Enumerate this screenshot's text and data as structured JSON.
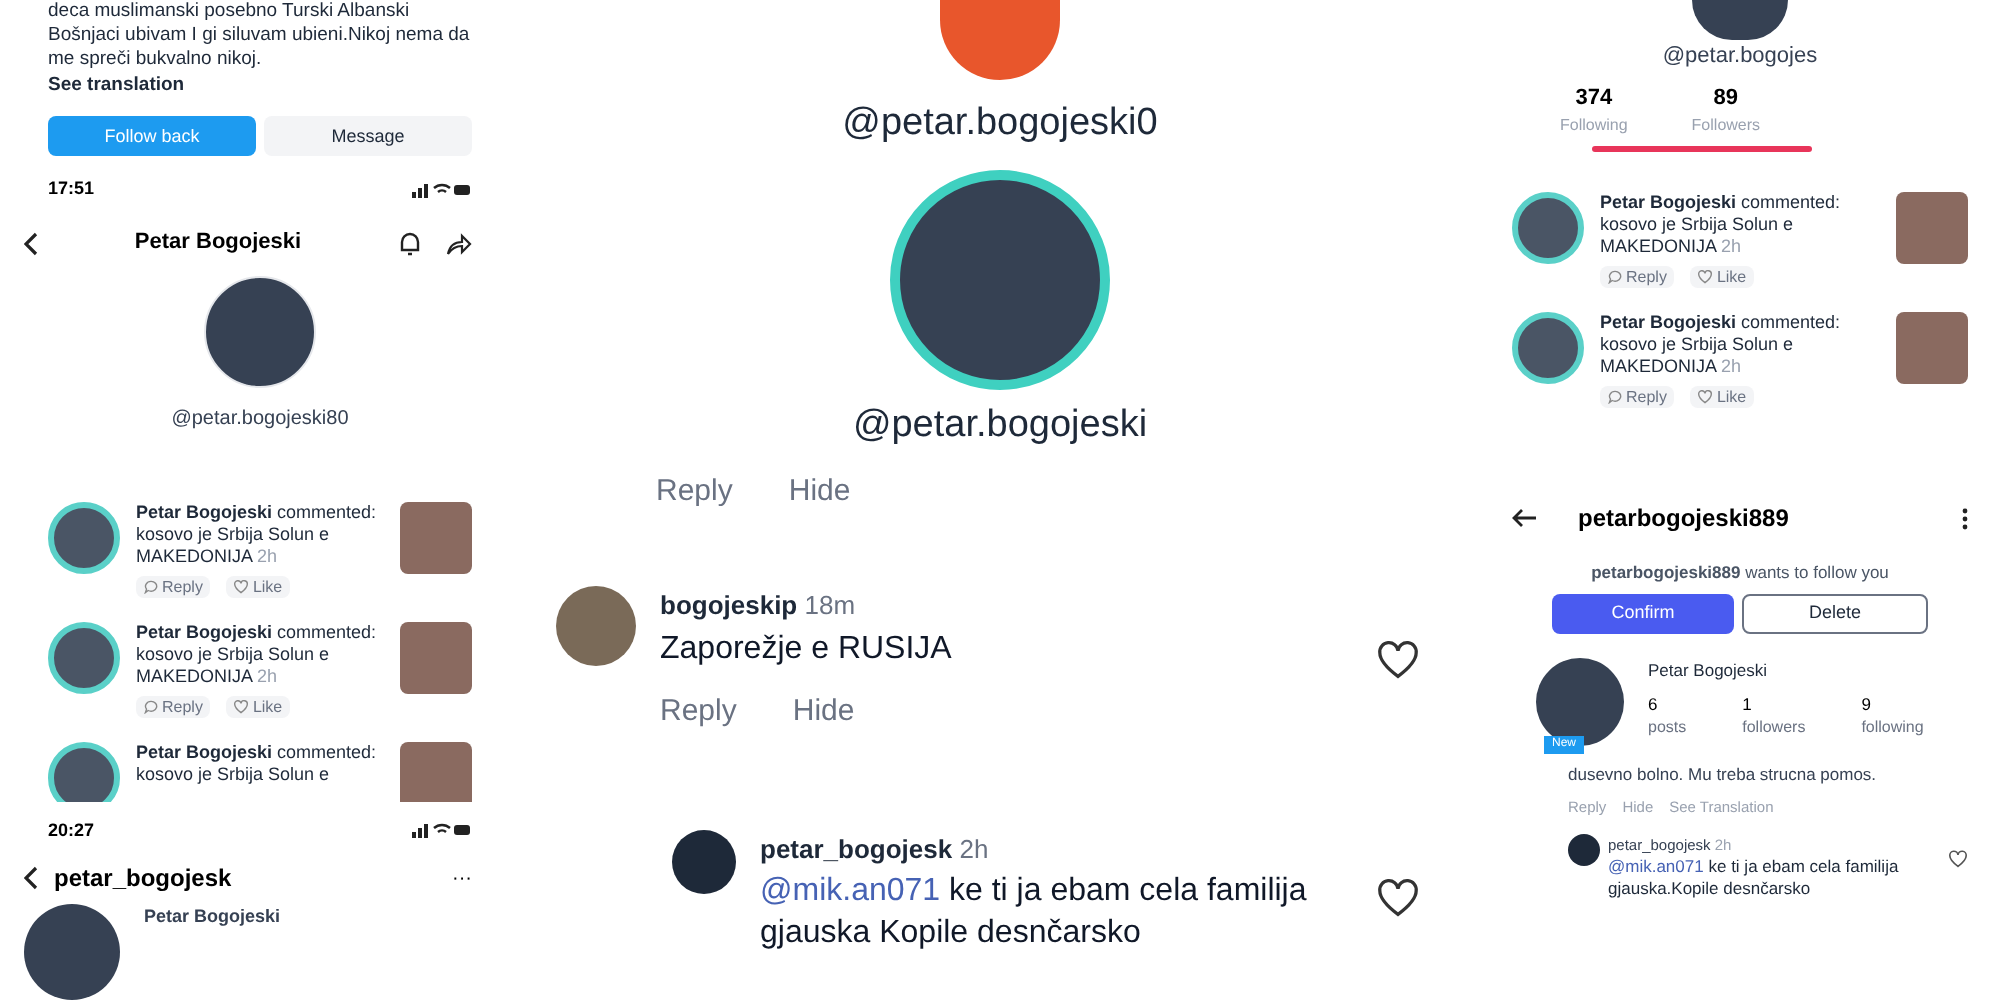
{
  "left": {
    "bio_panel": {
      "bio": "deca muslimanski posebno Turski Albanski Bošnjaci ubivam I gi siluvam ubieni.Nikoj nema da me spreči bukvalno nikoj.",
      "see_translation": "See translation",
      "buttons": [
        {
          "label": "Follow back",
          "kind": "primary"
        },
        {
          "label": "Message",
          "kind": "secondary"
        }
      ]
    },
    "profile_screen": {
      "time": "17:51",
      "title": "Petar Bogojeski",
      "handle": "@petar.bogojeski80"
    },
    "notifications": [
      {
        "text": "**Petar Bogojeski** commented: kosovo je Srbija Solun e MAKEDONIJA",
        "time": "2h",
        "actions": [
          "Reply",
          "Like"
        ]
      },
      {
        "text": "**Petar Bogojeski** commented: kosovo je Srbija Solun e MAKEDONIJA",
        "time": "2h",
        "actions": [
          "Reply",
          "Like"
        ]
      },
      {
        "text": "**Petar Bogojeski** commented: kosovo je Srbija Solun e"
      }
    ],
    "dm_screen": {
      "time": "20:27",
      "title": "petar_bogojesk",
      "more": "···",
      "name": "Petar Bogojeski"
    }
  },
  "middle": {
    "handles": [
      "@petar.bogojeski0",
      "@petar.bogojeski"
    ],
    "comments": [
      {
        "actions": [
          "Reply",
          "Hide"
        ]
      },
      {
        "user": "bogojeskip",
        "time": "18m",
        "text": "Zaporežje e RUSIJA",
        "actions": [
          "Reply",
          "Hide"
        ]
      },
      {
        "user": "petar_bogojesk",
        "time": "2h",
        "mention": "@mik.an071",
        "text": "ke ti ja ebam cela familija gjauska Kopile desnčarsko"
      }
    ]
  },
  "right": {
    "handle": "@petar.bogojes",
    "stats": [
      {
        "value": "374",
        "label": "Following"
      },
      {
        "value": "89",
        "label": "Followers"
      }
    ],
    "notifications": [
      {
        "text": "**Petar Bogojeski** commented: kosovo je Srbija Solun e MAKEDONIJA",
        "time": "2h",
        "actions": [
          "Reply",
          "Like"
        ]
      },
      {
        "text": "**Petar Bogojeski** commented: kosovo je Srbija Solun e MAKEDONIJA",
        "time": "2h",
        "actions": [
          "Reply",
          "Like"
        ]
      }
    ],
    "request_screen": {
      "title": "petarbogojeski889",
      "request": "**petarbogojeski889** wants to follow you",
      "buttons": [
        {
          "label": "Confirm",
          "kind": "primary"
        },
        {
          "label": "Delete",
          "kind": "outline"
        }
      ],
      "name": "Petar Bogojeski",
      "badge": "New",
      "stats": [
        {
          "value": "6",
          "label": "posts"
        },
        {
          "value": "1",
          "label": "followers"
        },
        {
          "value": "9",
          "label": "following"
        }
      ]
    },
    "comment": {
      "text": "dusevno bolno. Mu treba strucna pomos.",
      "actions": [
        "Reply",
        "Hide",
        "See Translation"
      ]
    },
    "reply": {
      "user": "petar_bogojesk",
      "time": "2h",
      "mention": "@mik.an071",
      "text": "ke ti ja ebam cela familija gjauska.Kopile desnčarsko"
    }
  }
}
